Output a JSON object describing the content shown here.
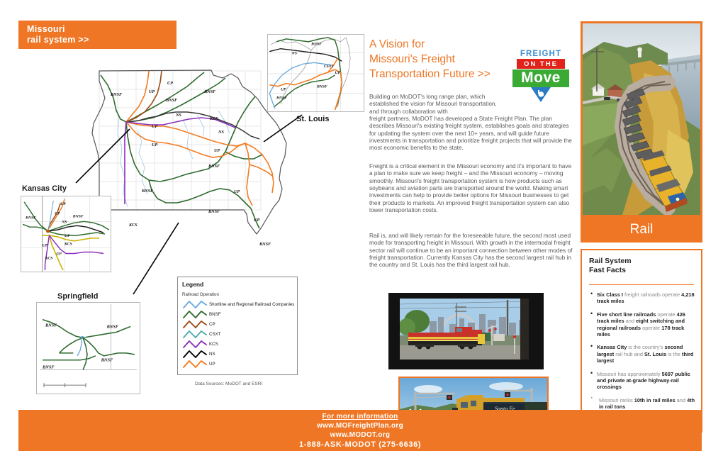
{
  "header": {
    "line1": "Missouri",
    "line2": "rail system >>",
    "bg_color": "#ee7624"
  },
  "title_block": {
    "line1": "A Vision for",
    "line2": "Missouri's Freight",
    "line3": "Transportation Future >>",
    "color": "#ee7624"
  },
  "logo": {
    "freight": "FREIGHT",
    "on_the": "ON THE",
    "move": "Move",
    "freight_color": "#3f8fd0",
    "on_the_color": "#e2231a",
    "move_color": "#3aaa35"
  },
  "body": {
    "para1_narrow": "Building on MoDOT's long range plan, which established the vision for Missouri transportation, and through collaboration with",
    "para1_rest": "freight partners, MoDOT has developed a State Freight Plan.  The plan describes Missouri's existing freight system, establishes goals and strategies for updating the system over the next 10+ years, and will guide future investments in transportation and prioritize freight projects that will provide the most economic benefits to the state.",
    "para2": "Freight is a critical element in the Missouri economy and it's important to have a plan to make sure we keep freight – and the Missouri economy – moving smoothly.  Missouri's freight transportation system is how products such as soybeans and aviation parts are transported around the world.  Making smart investments can help to provide better options for Missouri businesses to get their products to markets.  An improved freight transportation system can also lower transportation costs.",
    "para3": "Rail is, and will likely remain for the foreseeable future, the second most used mode for transporting freight in Missouri.  With growth in the intermodal freight sector rail will continue to be an important connection between other modes of freight transportation. Currently Kansas City has the second largest rail hub in the country and St. Louis has the third largest rail hub."
  },
  "rail_banner": {
    "label": "Rail"
  },
  "fast_facts": {
    "title_line1": "Rail System",
    "title_line2": "Fast Facts",
    "items": [
      {
        "parts": [
          {
            "text": "Six Class I",
            "bold": true
          },
          {
            "text": " freight railroads operate ",
            "bold": false
          },
          {
            "text": "4,218 track miles",
            "bold": true
          }
        ],
        "small_bullet": false
      },
      {
        "parts": [
          {
            "text": "Five short line railroads",
            "bold": true
          },
          {
            "text": " operate ",
            "bold": false
          },
          {
            "text": "426 track miles",
            "bold": true
          },
          {
            "text": " and ",
            "bold": false
          },
          {
            "text": "eight switching and regional railroads",
            "bold": true
          },
          {
            "text": " operate ",
            "bold": false
          },
          {
            "text": "178 track miles",
            "bold": true
          }
        ],
        "small_bullet": false
      },
      {
        "parts": [
          {
            "text": "Kansas City",
            "bold": true
          },
          {
            "text": " is the country's ",
            "bold": false
          },
          {
            "text": "second largest",
            "bold": true
          },
          {
            "text": " rail hub and ",
            "bold": false
          },
          {
            "text": "St. Louis",
            "bold": true
          },
          {
            "text": " is the ",
            "bold": false
          },
          {
            "text": "third largest",
            "bold": true
          }
        ],
        "small_bullet": false
      },
      {
        "parts": [
          {
            "text": "Missouri has approximately ",
            "bold": false
          },
          {
            "text": "5697 public and private at-grade highway-rail crossings",
            "bold": true
          }
        ],
        "small_bullet": false
      },
      {
        "parts": [
          {
            "text": "Missouri ranks ",
            "bold": false
          },
          {
            "text": "10th in rail miles",
            "bold": true
          },
          {
            "text": " and ",
            "bold": false
          },
          {
            "text": "4th in rail tons",
            "bold": true
          }
        ],
        "small_bullet": true
      }
    ]
  },
  "legend": {
    "title": "Legend",
    "subtitle": "Railroad Operation",
    "entries": [
      {
        "label": "Shortline and Regional Railroad Companies",
        "color": "#6aa9dd"
      },
      {
        "label": "BNSF",
        "color": "#2e6b2e"
      },
      {
        "label": "CP",
        "color": "#9c4a12"
      },
      {
        "label": "CSXT",
        "color": "#4aada8"
      },
      {
        "label": "KCS",
        "color": "#8b2fbe"
      },
      {
        "label": "NS",
        "color": "#000000"
      },
      {
        "label": "UP",
        "color": "#f47b20"
      }
    ]
  },
  "data_sources": "Data Sources: MoDOT and ESRI",
  "map_labels": {
    "st_louis": "St. Louis",
    "kansas_city": "Kansas City",
    "springfield": "Springfield"
  },
  "map_rail_tags": {
    "main": [
      "CP",
      "UP",
      "BNSF",
      "BNSF",
      "BNSF",
      "NS",
      "KCS",
      "NS",
      "UP",
      "UP",
      "UP",
      "BNSF",
      "UP",
      "BNSF",
      "UP",
      "BNSF",
      "KCS"
    ],
    "st_louis": [
      "BNSF",
      "NS",
      "CSXT",
      "UP",
      "UP",
      "BNSF",
      "BNSF"
    ],
    "kansas_city": [
      "UP",
      "CP",
      "BNSF",
      "NS",
      "BNSF",
      "UP",
      "KCS",
      "UP",
      "UP",
      "KCS"
    ],
    "springfield": [
      "BNSF",
      "BNSF",
      "BNSF",
      "BNSF"
    ]
  },
  "footer": {
    "line1": "For more information",
    "line2": "www.MOFreightPlan.org",
    "line3": "www.MODOT.org",
    "line4": "1-888-ASK-MODOT (275-6636)",
    "bg_color": "#ee7624"
  }
}
